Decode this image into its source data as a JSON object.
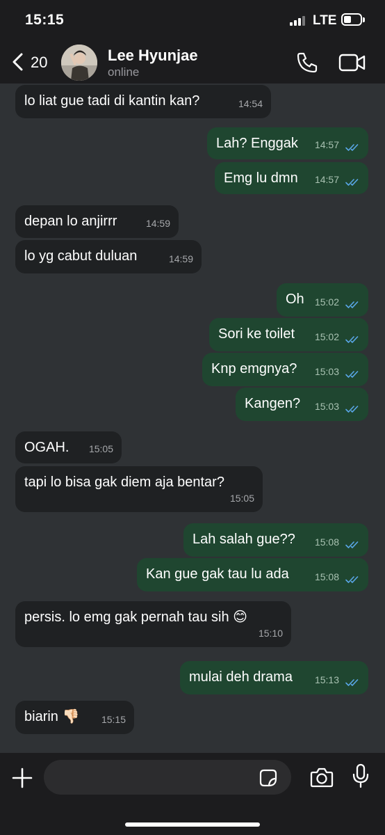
{
  "status_bar": {
    "time": "15:15",
    "network": "LTE",
    "battery_level": 0.45
  },
  "header": {
    "back_count": "20",
    "contact_name": "Lee Hyunjae",
    "contact_status": "online"
  },
  "messages": [
    {
      "dir": "in",
      "text": "lo liat gue tadi di kantin kan?",
      "time": "14:54"
    },
    {
      "dir": "out",
      "text": "Lah? Enggak",
      "time": "14:57",
      "read": true
    },
    {
      "dir": "out",
      "text": "Emg lu dmn",
      "time": "14:57",
      "read": true
    },
    {
      "dir": "in",
      "text": "depan lo anjirrr",
      "time": "14:59"
    },
    {
      "dir": "in",
      "text": "lo yg cabut duluan",
      "time": "14:59"
    },
    {
      "dir": "out",
      "text": "Oh",
      "time": "15:02",
      "read": true
    },
    {
      "dir": "out",
      "text": "Sori ke toilet",
      "time": "15:02",
      "read": true
    },
    {
      "dir": "out",
      "text": "Knp emgnya?",
      "time": "15:03",
      "read": true
    },
    {
      "dir": "out",
      "text": "Kangen?",
      "time": "15:03",
      "read": true
    },
    {
      "dir": "in",
      "text": "OGAH.",
      "time": "15:05"
    },
    {
      "dir": "in",
      "text": "tapi lo bisa gak diem aja bentar?",
      "time": "15:05"
    },
    {
      "dir": "out",
      "text": "Lah salah gue??",
      "time": "15:08",
      "read": true
    },
    {
      "dir": "out",
      "text": "Kan gue gak tau lu ada",
      "time": "15:08",
      "read": true
    },
    {
      "dir": "in",
      "text": "persis. lo emg gak pernah tau sih 😊",
      "time": "15:10"
    },
    {
      "dir": "out",
      "text": "mulai deh drama",
      "time": "15:13",
      "read": true
    },
    {
      "dir": "in",
      "text": "biarin 👎🏻",
      "time": "15:15"
    }
  ],
  "input": {
    "placeholder": ""
  },
  "icons": {
    "back": "chevron-left-icon",
    "call": "phone-icon",
    "video": "video-camera-icon",
    "attach": "plus-icon",
    "sticker": "sticker-icon",
    "camera": "camera-icon",
    "mic": "microphone-icon",
    "read_receipt": "double-check-icon"
  },
  "colors": {
    "chat_bg": "#2f3235",
    "incoming_bubble": "#1f2123",
    "outgoing_bubble": "#1f4630",
    "read_tick": "#5aa7e8",
    "bar_bg": "#1c1c1e"
  }
}
